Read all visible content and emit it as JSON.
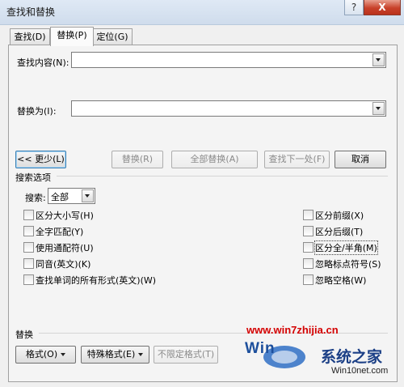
{
  "window": {
    "title": "查找和替换",
    "help_label": "?",
    "close_label": "X"
  },
  "tabs": [
    {
      "label": "查找(D)"
    },
    {
      "label": "替换(P)"
    },
    {
      "label": "定位(G)"
    }
  ],
  "find": {
    "label": "查找内容(N):",
    "value": ""
  },
  "replace": {
    "label": "替换为(I):",
    "value": ""
  },
  "buttons": {
    "less": "<< 更少(L)",
    "replace": "替换(R)",
    "replace_all": "全部替换(A)",
    "find_next": "查找下一处(F)",
    "cancel": "取消"
  },
  "search_options": {
    "title": "搜索选项",
    "search_label": "搜索:",
    "search_value": "全部",
    "left_options": [
      "区分大小写(H)",
      "全字匹配(Y)",
      "使用通配符(U)",
      "同音(英文)(K)",
      "查找单词的所有形式(英文)(W)"
    ],
    "right_options": [
      "区分前缀(X)",
      "区分后缀(T)",
      "区分全/半角(M)",
      "忽略标点符号(S)",
      "忽略空格(W)"
    ]
  },
  "replace_section": {
    "title": "替换",
    "format_button": "格式(O)",
    "special_button": "特殊格式(E)",
    "no_format_button": "不限定格式(T)"
  },
  "watermark": {
    "url": "www.win7zhijia.cn",
    "logo_text": "Win",
    "brand": "系统之家",
    "site": "Win10net.com"
  }
}
